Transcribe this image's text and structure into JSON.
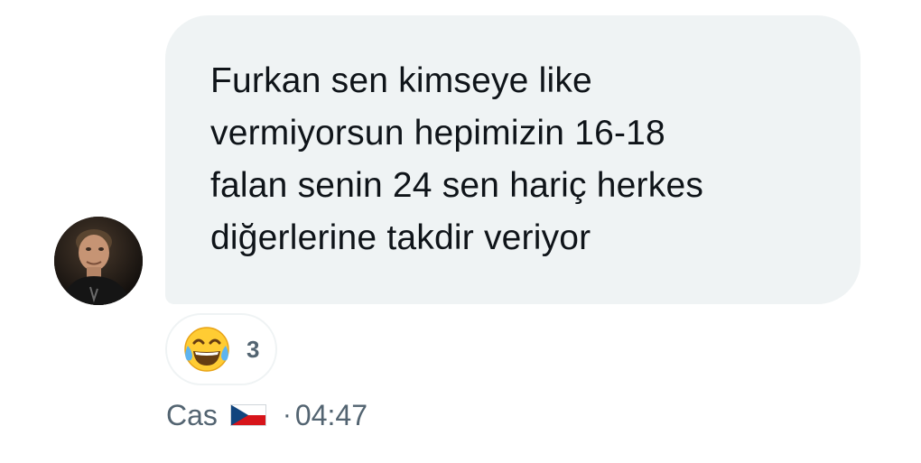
{
  "message": {
    "lines": [
      "Furkan sen kimseye like",
      "vermiyorsun hepimizin 16-18",
      "falan senin 24 sen hariç herkes",
      "diğerlerine takdir veriyor"
    ]
  },
  "reaction": {
    "emoji_icon": "face-with-tears-of-joy-icon",
    "count": "3"
  },
  "meta": {
    "sender": "Cas",
    "flag_icon": "czech-flag-icon",
    "separator": "·",
    "time": "04:47"
  },
  "colors": {
    "bubble_bg": "#eff3f4",
    "text": "#0f1419",
    "meta_text": "#536471"
  }
}
